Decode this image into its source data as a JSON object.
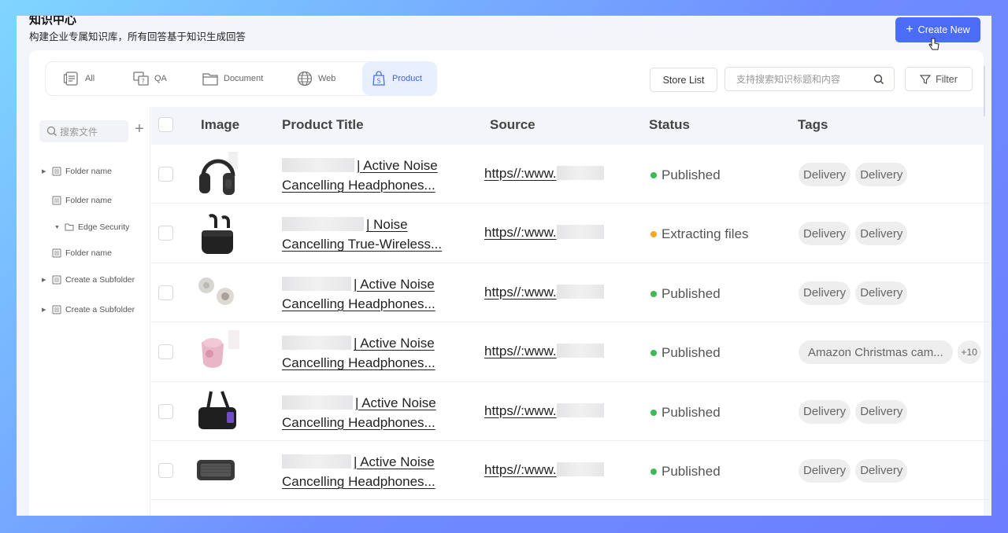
{
  "header": {
    "title": "知识中心",
    "subtitle": "构建企业专属知识库，所有回答基于知识生成回答",
    "create_label": "Create New"
  },
  "tabs": [
    {
      "label": "All",
      "icon": "doc-list-icon"
    },
    {
      "label": "QA",
      "icon": "qa-icon"
    },
    {
      "label": "Document",
      "icon": "folder-icon"
    },
    {
      "label": "Web",
      "icon": "globe-icon"
    },
    {
      "label": "Product",
      "icon": "shopping-bag-icon",
      "active": true
    }
  ],
  "toolbar": {
    "store_list_label": "Store List",
    "search_placeholder": "支持搜索知识标题和内容",
    "filter_label": "Filter"
  },
  "sidebar": {
    "search_placeholder": "搜索文件",
    "items": [
      {
        "label": "Folder name",
        "expandable": true,
        "icon": "doc-icon"
      },
      {
        "label": "Folder name",
        "expandable": false,
        "icon": "doc-icon"
      },
      {
        "label": "Edge Security",
        "expanded": true,
        "icon": "folder-icon"
      },
      {
        "label": "Folder name",
        "expandable": false,
        "icon": "doc-icon"
      },
      {
        "label": "Create a Subfolder",
        "expandable": true,
        "icon": "doc-icon"
      },
      {
        "label": "Create a Subfolder",
        "expandable": true,
        "icon": "doc-icon"
      }
    ]
  },
  "table": {
    "columns": [
      "Image",
      "Product Title",
      "Source",
      "Status",
      "Tags"
    ],
    "rows": [
      {
        "image": "over-ear-headphones",
        "title_line1": "| Active Noise",
        "title_line2": "Cancelling Headphones...",
        "source": "https//:www.",
        "status": "Published",
        "tags": [
          "Delivery",
          "Delivery"
        ]
      },
      {
        "image": "wireless-earbuds-case",
        "title_line1": "| Noise",
        "title_line2": "Cancelling True-Wireless...",
        "source": "https//:www.",
        "status": "Extracting files",
        "tags": [
          "Delivery",
          "Delivery"
        ]
      },
      {
        "image": "earbuds-pair",
        "title_line1": "| Active Noise",
        "title_line2": "Cancelling Headphones...",
        "source": "https//:www.",
        "status": "Published",
        "tags": [
          "Delivery",
          "Delivery"
        ]
      },
      {
        "image": "pink-earbuds-case",
        "title_line1": "| Active Noise",
        "title_line2": "Cancelling Headphones...",
        "source": "https//:www.",
        "status": "Published",
        "tags": [
          "Amazon Christmas cam...",
          "+10"
        ]
      },
      {
        "image": "portable-speaker-strap",
        "title_line1": "| Active Noise",
        "title_line2": "Cancelling Headphones...",
        "source": "https//:www.",
        "status": "Published",
        "tags": [
          "Delivery",
          "Delivery"
        ]
      },
      {
        "image": "bluetooth-speaker",
        "title_line1": "| Active Noise",
        "title_line2": "Cancelling Headphones...",
        "source": "https//:www.",
        "status": "Published",
        "tags": [
          "Delivery",
          "Delivery"
        ]
      }
    ]
  },
  "colors": {
    "accent": "#4a6cf7",
    "published": "#3dba55",
    "extracting": "#f5a623",
    "active_tab_bg": "#e8efff"
  }
}
